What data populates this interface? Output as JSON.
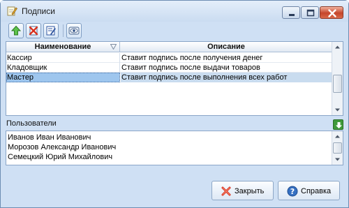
{
  "window": {
    "title": "Подписи",
    "title_icon": "edit-note-icon"
  },
  "toolbar": {
    "buttons": [
      {
        "icon": "add-up-arrow-icon"
      },
      {
        "icon": "delete-icon"
      },
      {
        "icon": "edit-icon"
      },
      {
        "icon": "view-eye-icon"
      }
    ]
  },
  "grid": {
    "columns": [
      "Наименование",
      "Описание"
    ],
    "rows": [
      {
        "name": "Кассир",
        "description": "Ставит подпись после получения денег"
      },
      {
        "name": "Кладовщик",
        "description": "Ставит подпись после выдачи товаров"
      },
      {
        "name": "Мастер",
        "description": "Ставит подпись после выполнения всех работ"
      }
    ],
    "selected_index": 2
  },
  "users": {
    "label": "Пользователи",
    "items": [
      "Иванов Иван Иванович",
      "Морозов Александр Иванович",
      "Семецкий Юрий Михайлович"
    ]
  },
  "footer": {
    "close_label": "Закрыть",
    "help_label": "Справка"
  },
  "colors": {
    "window_bg": "#cfe0f4",
    "selection": "#9ec6ee",
    "close_button": "#c5452a"
  }
}
